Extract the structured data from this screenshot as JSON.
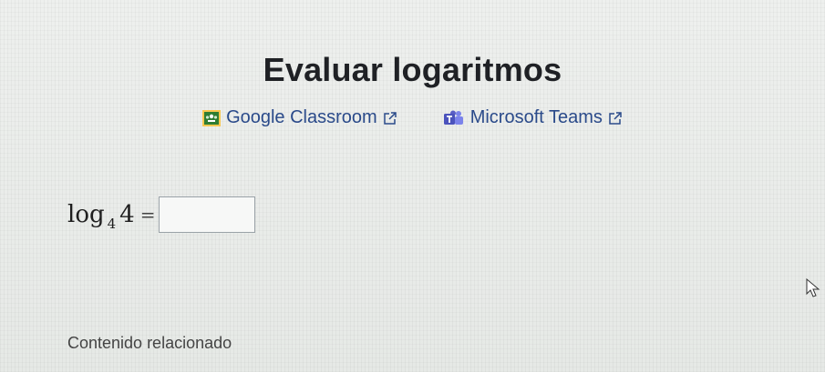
{
  "page": {
    "title": "Evaluar logaritmos"
  },
  "share": {
    "google_classroom": "Google Classroom",
    "microsoft_teams": "Microsoft Teams"
  },
  "problem": {
    "func": "log",
    "base": "4",
    "argument": "4",
    "equals": "=",
    "answer_value": ""
  },
  "related": {
    "heading": "Contenido relacionado"
  },
  "icons": {
    "google_classroom": "google-classroom-icon",
    "microsoft_teams": "microsoft-teams-icon",
    "external_link": "external-link-icon",
    "cursor": "mouse-cursor-icon"
  },
  "colors": {
    "link": "#2a4a8a",
    "classroom_green": "#2e7d32",
    "classroom_yellow": "#f9c74f",
    "teams_purple": "#5b5fc7"
  }
}
